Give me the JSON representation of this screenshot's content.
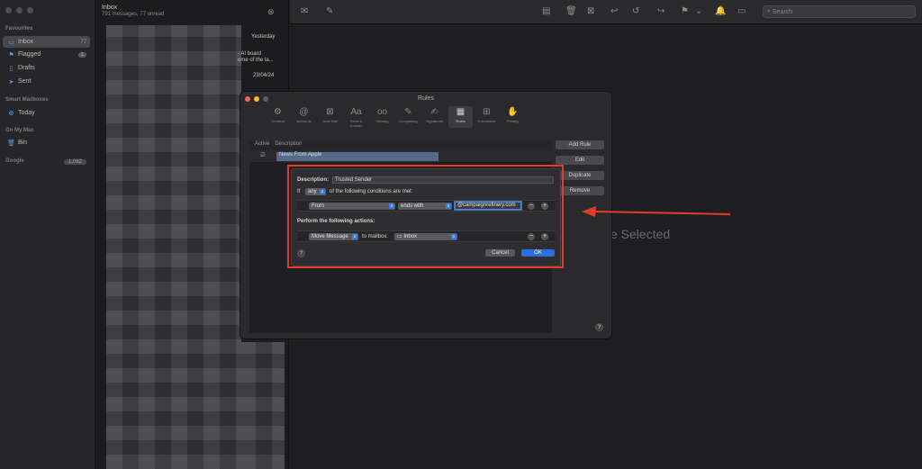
{
  "sidebar": {
    "sections": {
      "favourites": "Favourites",
      "smart": "Smart Mailboxes",
      "onmymac": "On My Mac",
      "google": "Google"
    },
    "google_badge": "1,062",
    "items": [
      {
        "label": "Inbox",
        "badge": "77",
        "icon": "inbox-icon"
      },
      {
        "label": "Flagged",
        "badge": "1",
        "icon": "flag-icon"
      },
      {
        "label": "Drafts",
        "icon": "document-icon"
      },
      {
        "label": "Sent",
        "icon": "paperplane-icon"
      },
      {
        "label": "Today",
        "icon": "gear-icon"
      },
      {
        "label": "Bin",
        "icon": "trash-icon"
      }
    ]
  },
  "list": {
    "title": "Inbox",
    "subtitle": "791 messages, 77 unread",
    "dates": [
      "Yesterday",
      "23/04/24"
    ],
    "snippet1": "- AI board",
    "snippet2": "ome of the la..."
  },
  "toolbar": {
    "search_placeholder": "Search"
  },
  "viewer": {
    "empty_text": "e Selected"
  },
  "rules": {
    "title": "Rules",
    "tabs": [
      "General",
      "Accounts",
      "Junk Mail",
      "Fonts & Colours",
      "Viewing",
      "Composing",
      "Signatures",
      "Rules",
      "Extensions",
      "Privacy"
    ],
    "col_active": "Active",
    "col_description": "Description",
    "row_description": "News From Apple",
    "buttons": {
      "add": "Add Rule",
      "edit": "Edit",
      "duplicate": "Duplicate",
      "remove": "Remove"
    }
  },
  "sheet": {
    "description_label": "Description:",
    "description_value": "Trusted Sender",
    "if_label": "If",
    "any_value": "any",
    "conditions_text": "of the following conditions are met:",
    "condition_field": "From",
    "condition_op": "ends with",
    "condition_value": "@campaignrefinery.com",
    "actions_label": "Perform the following actions:",
    "action": "Move Message",
    "to_mailbox_label": "to mailbox:",
    "mailbox": "Inbox",
    "cancel": "Cancel",
    "ok": "OK"
  },
  "colors": {
    "highlight": "#e33b2b",
    "accent": "#2a6fe0"
  }
}
